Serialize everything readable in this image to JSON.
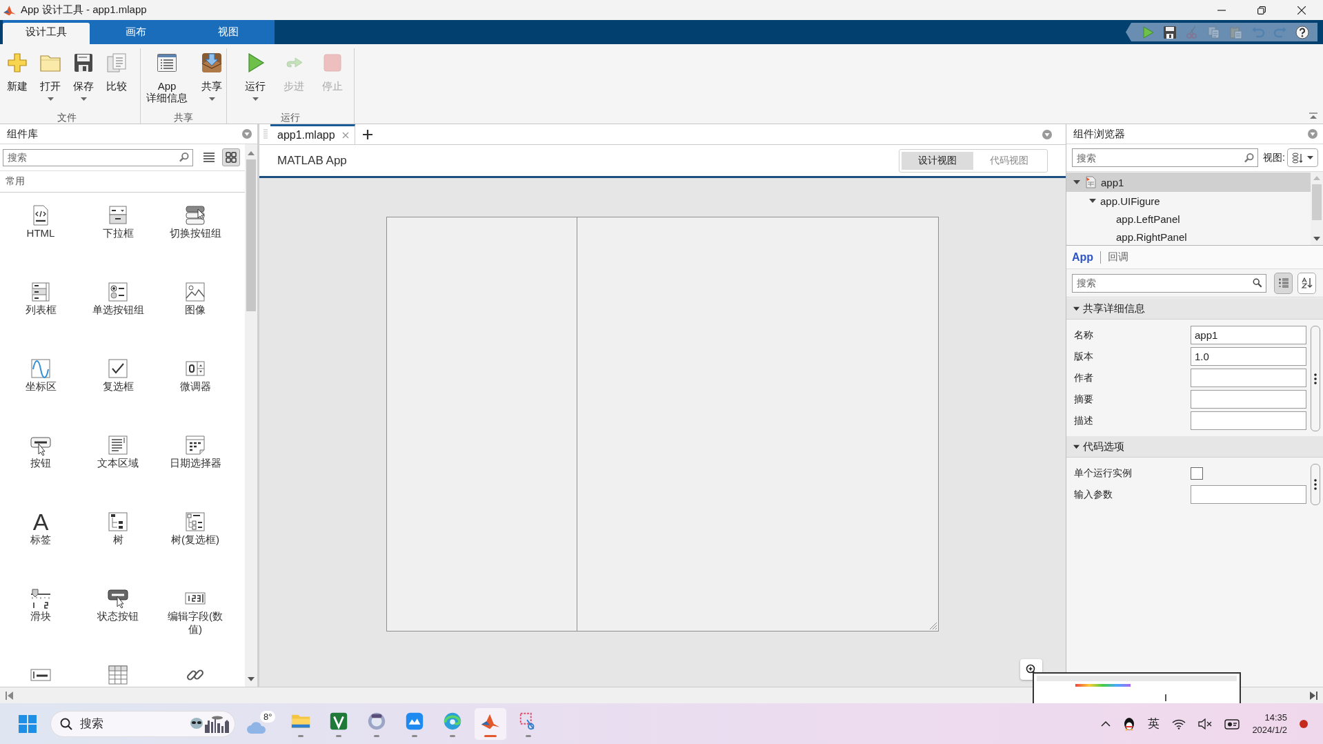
{
  "window": {
    "title": "App 设计工具 - app1.mlapp"
  },
  "ribbon_tabs": [
    {
      "label": "设计工具",
      "selected": true
    },
    {
      "label": "画布",
      "selected": false
    },
    {
      "label": "视图",
      "selected": false
    }
  ],
  "quick_access": [
    {
      "kind": "run",
      "disabled": false
    },
    {
      "kind": "save",
      "disabled": false
    },
    {
      "kind": "cut",
      "disabled": true
    },
    {
      "kind": "copy",
      "disabled": true
    },
    {
      "kind": "paste",
      "disabled": true
    },
    {
      "kind": "undo",
      "disabled": true
    },
    {
      "kind": "redo",
      "disabled": true
    },
    {
      "kind": "help",
      "disabled": false
    }
  ],
  "ribbon_groups": [
    {
      "label": "文件",
      "buttons": [
        {
          "kind": "new",
          "label": "新建",
          "dropdown": false,
          "disabled": false
        },
        {
          "kind": "open",
          "label": "打开",
          "dropdown": true,
          "disabled": false
        },
        {
          "kind": "save",
          "label": "保存",
          "dropdown": true,
          "disabled": false
        },
        {
          "kind": "compare",
          "label": "比较",
          "dropdown": false,
          "disabled": false
        }
      ]
    },
    {
      "label": "共享",
      "buttons": [
        {
          "kind": "details",
          "label": "App 详细信息",
          "dropdown": false,
          "disabled": false
        },
        {
          "kind": "share",
          "label": "共享",
          "dropdown": true,
          "disabled": false
        }
      ]
    },
    {
      "label": "运行",
      "buttons": [
        {
          "kind": "run",
          "label": "运行",
          "dropdown": true,
          "disabled": false
        },
        {
          "kind": "step",
          "label": "步进",
          "dropdown": false,
          "disabled": true
        },
        {
          "kind": "stop",
          "label": "停止",
          "dropdown": false,
          "disabled": true
        }
      ]
    }
  ],
  "component_library": {
    "title": "组件库",
    "search": {
      "placeholder": "搜索"
    },
    "view_modes": [
      {
        "kind": "list",
        "selected": false
      },
      {
        "kind": "grid",
        "selected": true
      }
    ],
    "section": "常用",
    "items": [
      {
        "kind": "html",
        "label": "HTML"
      },
      {
        "kind": "dropdown",
        "label": "下拉框"
      },
      {
        "kind": "toggle-group",
        "label": "切换按钮组"
      },
      {
        "kind": "listbox",
        "label": "列表框"
      },
      {
        "kind": "radio-group",
        "label": "单选按钮组"
      },
      {
        "kind": "image",
        "label": "图像"
      },
      {
        "kind": "axes",
        "label": "坐标区"
      },
      {
        "kind": "checkbox",
        "label": "复选框"
      },
      {
        "kind": "spinner",
        "label": "微调器"
      },
      {
        "kind": "button",
        "label": "按钮"
      },
      {
        "kind": "textarea",
        "label": "文本区域"
      },
      {
        "kind": "datepicker",
        "label": "日期选择器"
      },
      {
        "kind": "label",
        "label": "标签",
        "icon": "A"
      },
      {
        "kind": "tree",
        "label": "树"
      },
      {
        "kind": "checktree",
        "label": "树(复选框)"
      },
      {
        "kind": "slider",
        "label": "滑块"
      },
      {
        "kind": "statebutton",
        "label": "状态按钮"
      },
      {
        "kind": "numericfield",
        "label": "编辑字段(数值)"
      },
      {
        "kind": "textfield"
      },
      {
        "kind": "table"
      },
      {
        "kind": "hyperlink"
      }
    ]
  },
  "document_tabs": [
    {
      "label": "app1.mlapp",
      "selected": true
    }
  ],
  "designer": {
    "title": "MATLAB App",
    "views": [
      {
        "label": "设计视图",
        "selected": true
      },
      {
        "label": "代码视图",
        "selected": false
      }
    ]
  },
  "component_browser": {
    "title": "组件浏览器",
    "search": {
      "placeholder": "搜索"
    },
    "view_label": "视图:",
    "tree": [
      {
        "kind": "app",
        "label": "app1",
        "selected": true,
        "expanded": true,
        "children": [
          {
            "label": "app.UIFigure",
            "selected": false,
            "expanded": true,
            "children": [
              {
                "label": "app.LeftPanel",
                "selected": false
              },
              {
                "label": "app.RightPanel",
                "selected": false
              }
            ]
          }
        ]
      }
    ],
    "inspector_tabs": [
      {
        "label": "App",
        "selected": true
      },
      {
        "label": "回调",
        "selected": false
      }
    ],
    "inspector_search": {
      "placeholder": "搜索"
    },
    "sort_buttons": [
      {
        "kind": "grouped",
        "selected": true
      },
      {
        "kind": "alphabetical",
        "selected": false
      }
    ],
    "sections": [
      {
        "title": "共享详细信息",
        "expanded": true,
        "properties": [
          {
            "kind": "text",
            "label": "名称",
            "value": "app1"
          },
          {
            "kind": "text",
            "label": "版本",
            "value": "1.0"
          },
          {
            "kind": "text",
            "label": "作者"
          },
          {
            "kind": "text",
            "label": "摘要"
          },
          {
            "kind": "text",
            "label": "描述"
          }
        ]
      },
      {
        "title": "代码选项",
        "expanded": true,
        "properties": [
          {
            "kind": "checkbox",
            "label": "单个运行实例",
            "checked": false
          },
          {
            "kind": "text",
            "label": "输入参数"
          }
        ]
      }
    ]
  },
  "taskbar": {
    "search": {
      "placeholder": "搜索"
    },
    "weather": "8°",
    "apps": [
      {
        "kind": "files",
        "running": true,
        "active": false
      },
      {
        "kind": "tile",
        "running": true,
        "active": false
      },
      {
        "kind": "round",
        "running": true,
        "active": false
      },
      {
        "kind": "cloud-tile",
        "running": true,
        "active": false
      },
      {
        "kind": "browser",
        "running": true,
        "active": false
      },
      {
        "kind": "peak",
        "running": true,
        "active": true
      },
      {
        "kind": "snip",
        "running": true,
        "active": false
      }
    ],
    "ime": "英",
    "time": "14:35",
    "date": "2024/1/2"
  }
}
